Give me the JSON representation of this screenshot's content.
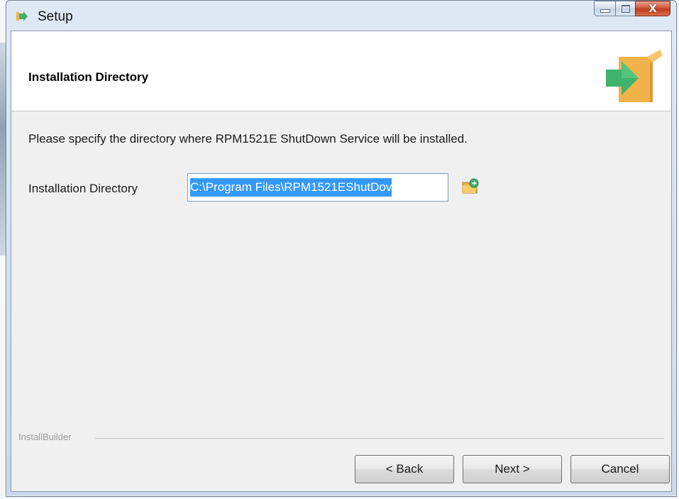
{
  "window": {
    "title": "Setup",
    "close_glyph": "X"
  },
  "icons": {
    "app": "setup-arrow-icon",
    "header_logo": "package-arrow-icon",
    "browse": "browse-folder-icon",
    "minimize": "minimize-icon",
    "maximize": "maximize-icon",
    "close": "close-icon"
  },
  "header": {
    "title": "Installation Directory"
  },
  "main": {
    "description": "Please specify the directory where RPM1521E ShutDown Service will be installed.",
    "dir_label": "Installation Directory",
    "dir_value": "C:\\Program Files\\RPM1521EShutDov"
  },
  "footer": {
    "brand": "InstallBuilder",
    "back_label": "< Back",
    "next_label": "Next >",
    "cancel_label": "Cancel"
  },
  "colors": {
    "accent_selection": "#3399ff",
    "logo_box": "#f2b24a",
    "logo_arrow": "#3fb36b",
    "close_button": "#c9462a"
  }
}
